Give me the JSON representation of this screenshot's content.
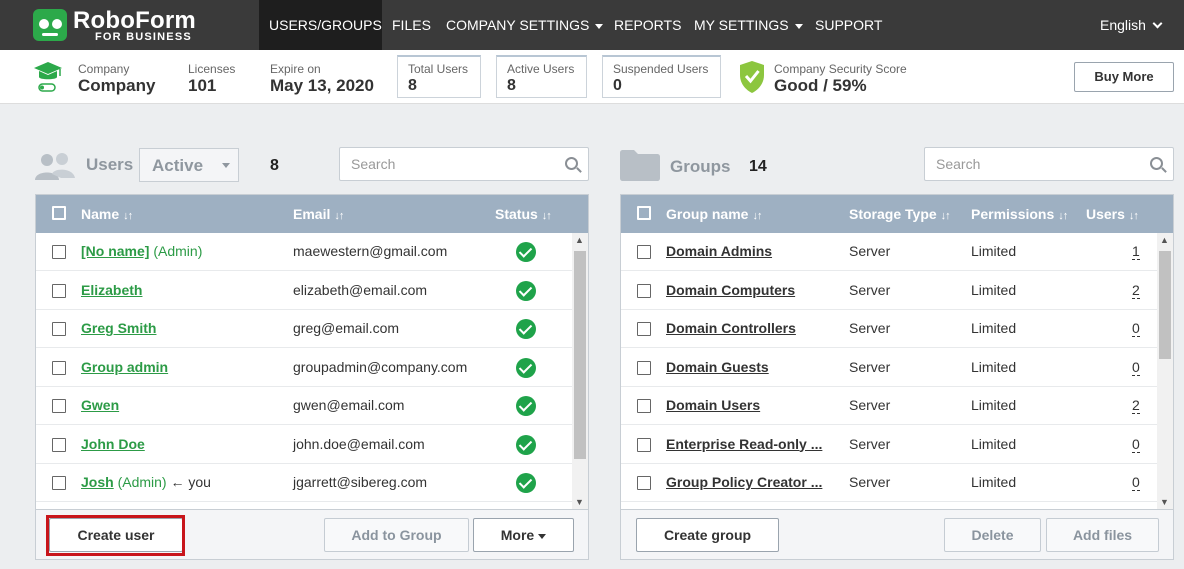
{
  "brand": {
    "name": "RoboForm",
    "sub": "FOR BUSINESS"
  },
  "nav": {
    "items": [
      "USERS/GROUPS",
      "FILES",
      "COMPANY SETTINGS",
      "REPORTS",
      "MY SETTINGS",
      "SUPPORT"
    ],
    "language": "English"
  },
  "info": {
    "company_label": "Company",
    "company_value": "Company",
    "licenses_label": "Licenses",
    "licenses_value": "101",
    "expire_label": "Expire on",
    "expire_value": "May 13, 2020",
    "total_label": "Total Users",
    "total_value": "8",
    "active_label": "Active Users",
    "active_value": "8",
    "suspended_label": "Suspended Users",
    "suspended_value": "0",
    "score_label": "Company Security Score",
    "score_value": "Good / 59%",
    "buy_more": "Buy More"
  },
  "users_panel": {
    "title": "Users",
    "filter": "Active",
    "count": "8",
    "search_placeholder": "Search",
    "headers": {
      "name": "Name",
      "email": "Email",
      "status": "Status"
    },
    "rows": [
      {
        "name": "[No name]",
        "tag": "(Admin)",
        "suffix": "",
        "email": "maewestern@gmail.com"
      },
      {
        "name": "Elizabeth",
        "tag": "",
        "suffix": "",
        "email": "elizabeth@email.com"
      },
      {
        "name": "Greg Smith",
        "tag": "",
        "suffix": "",
        "email": "greg@email.com"
      },
      {
        "name": "Group admin",
        "tag": "",
        "suffix": "",
        "email": "groupadmin@company.com"
      },
      {
        "name": "Gwen",
        "tag": "",
        "suffix": "",
        "email": "gwen@email.com"
      },
      {
        "name": "John Doe",
        "tag": "",
        "suffix": "",
        "email": "john.doe@email.com"
      },
      {
        "name": "Josh",
        "tag": "(Admin)",
        "suffix": "← you",
        "email": "jgarrett@sibereg.com"
      }
    ],
    "buttons": {
      "create": "Create user",
      "add_group": "Add to Group",
      "more": "More"
    }
  },
  "groups_panel": {
    "title": "Groups",
    "count": "14",
    "search_placeholder": "Search",
    "headers": {
      "name": "Group name",
      "storage": "Storage Type",
      "permissions": "Permissions",
      "users": "Users"
    },
    "rows": [
      {
        "name": "Domain Admins",
        "storage": "Server",
        "permissions": "Limited",
        "users": "1"
      },
      {
        "name": "Domain Computers",
        "storage": "Server",
        "permissions": "Limited",
        "users": "2"
      },
      {
        "name": "Domain Controllers",
        "storage": "Server",
        "permissions": "Limited",
        "users": "0"
      },
      {
        "name": "Domain Guests",
        "storage": "Server",
        "permissions": "Limited",
        "users": "0"
      },
      {
        "name": "Domain Users",
        "storage": "Server",
        "permissions": "Limited",
        "users": "2"
      },
      {
        "name": "Enterprise Read-only ...",
        "storage": "Server",
        "permissions": "Limited",
        "users": "0"
      },
      {
        "name": "Group Policy Creator ...",
        "storage": "Server",
        "permissions": "Limited",
        "users": "0"
      }
    ],
    "buttons": {
      "create": "Create group",
      "delete": "Delete",
      "add_files": "Add files"
    }
  },
  "colors": {
    "nav_bg": "#3a3a3a",
    "accent_green": "#2c9b46",
    "table_header": "#9eb0c2",
    "highlight": "#c8151b"
  }
}
